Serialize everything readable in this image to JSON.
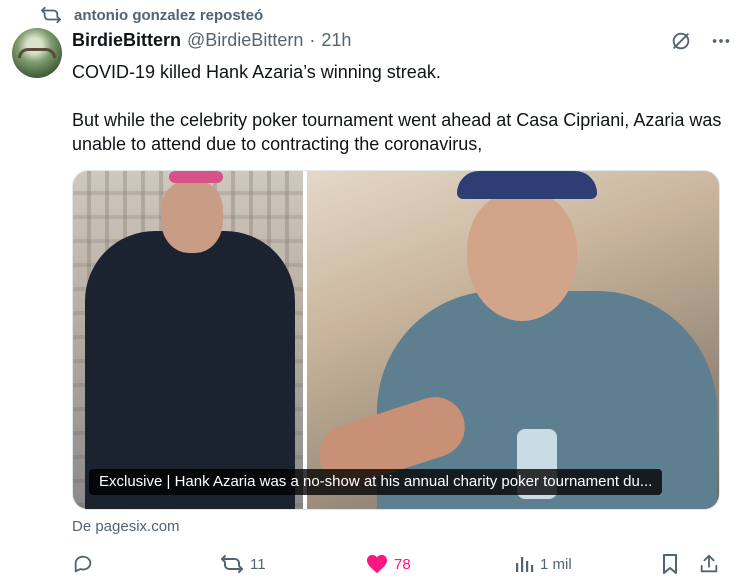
{
  "repost": {
    "text": "antonio gonzalez reposteó"
  },
  "tweet": {
    "author_name": "BirdieBittern",
    "handle": "@BirdieBittern",
    "separator": "·",
    "time": "21h",
    "lines": [
      "COVID-19 killed Hank Azaria’s winning streak.",
      "But while the celebrity poker tournament went ahead at Casa Cipriani, Azaria was unable to attend due to contracting the coronavirus,"
    ],
    "card_caption": "Exclusive | Hank Azaria was a no-show at his annual charity poker tournament du...",
    "source": "De pagesix.com"
  },
  "actions": {
    "retweets": "11",
    "likes": "78",
    "views": "1 mil"
  },
  "colors": {
    "accent_like": "#f91880",
    "muted": "#536471",
    "text": "#0f1419"
  },
  "icons": [
    "repost-icon",
    "grok-icon",
    "more-icon",
    "reply-icon",
    "retweet-icon",
    "like-icon",
    "views-icon",
    "bookmark-icon",
    "share-icon"
  ]
}
